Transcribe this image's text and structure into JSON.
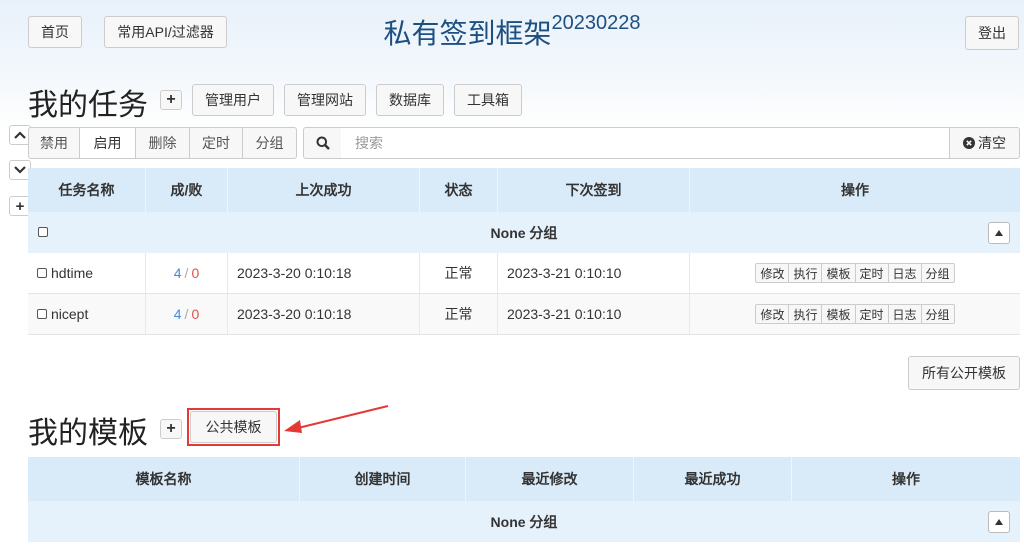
{
  "header": {
    "home": "首页",
    "api_filter": "常用API/过滤器",
    "title": "私有签到框架",
    "version": "20230228",
    "logout": "登出"
  },
  "tasks_section": {
    "heading": "我的任务",
    "add_icon": "plus-icon",
    "buttons": [
      "管理用户",
      "管理网站",
      "数据库",
      "工具箱"
    ]
  },
  "toolbar": {
    "disable": "禁用",
    "enable": "启用",
    "delete": "删除",
    "schedule": "定时",
    "group": "分组",
    "search_placeholder": "搜索",
    "clear": "清空"
  },
  "task_table": {
    "headers": [
      "任务名称",
      "成/败",
      "上次成功",
      "状态",
      "下次签到",
      "操作"
    ],
    "group_label": "None 分组",
    "rows": [
      {
        "name": "hdtime",
        "success": "4",
        "sep": "/",
        "fail": "0",
        "last_success": "2023-3-20 0:10:18",
        "status": "正常",
        "next": "2023-3-21 0:10:10"
      },
      {
        "name": "nicept",
        "success": "4",
        "sep": "/",
        "fail": "0",
        "last_success": "2023-3-20 0:10:18",
        "status": "正常",
        "next": "2023-3-21 0:10:10"
      }
    ],
    "ops": [
      "修改",
      "执行",
      "模板",
      "定时",
      "日志",
      "分组"
    ]
  },
  "all_public_templates": "所有公开模板",
  "templates_section": {
    "heading": "我的模板",
    "public_templates": "公共模板"
  },
  "template_table": {
    "headers": [
      "模板名称",
      "创建时间",
      "最近修改",
      "最近成功",
      "操作"
    ],
    "group_label": "None 分组"
  },
  "colors": {
    "accent_title": "#1d4f80",
    "success": "#4a8ad0",
    "fail": "#d9534f",
    "annotation": "#e53935"
  }
}
